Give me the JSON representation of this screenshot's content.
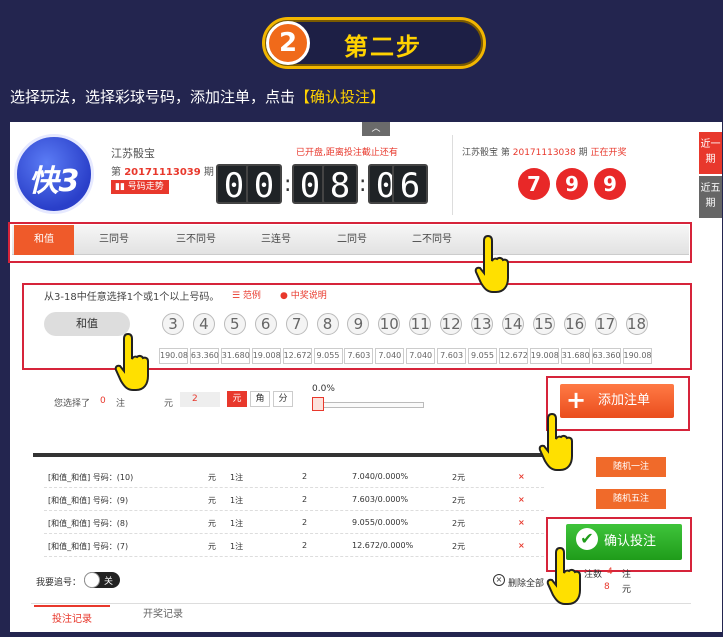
{
  "step": {
    "number": "2",
    "title": "第二步"
  },
  "intro": {
    "prefix": "选择玩法，选择彩球号码，添加注单，点击",
    "highlight": "【确认投注】"
  },
  "game": {
    "logo_text": "快3",
    "name": "江苏骰宝",
    "issue_prefix": "第",
    "issue": "20171113039",
    "issue_suffix": "期",
    "trend_label": "号码走势",
    "countdown_note": "已开盘,距离投注截止还有",
    "countdown": [
      "0",
      "0",
      "0",
      "8",
      "0",
      "6"
    ]
  },
  "result": {
    "name": "江苏骰宝 第",
    "issue": "20171113038",
    "suffix": "期",
    "status": "正在开奖",
    "balls": [
      "7",
      "9",
      "9"
    ]
  },
  "side_tabs": [
    "近一期",
    "近五期"
  ],
  "tabs": [
    "和值",
    "三同号",
    "三不同号",
    "三连号",
    "二同号",
    "二不同号"
  ],
  "hint": "从3-18中任意选择1个或1个以上号码。",
  "hint_links": [
    "☰ 范例",
    "● 中奖说明"
  ],
  "sum_label": "和值",
  "numbers": [
    "3",
    "4",
    "5",
    "6",
    "7",
    "8",
    "9",
    "10",
    "11",
    "12",
    "13",
    "14",
    "15",
    "16",
    "17",
    "18"
  ],
  "odds": [
    "190.08",
    "63.360",
    "31.680",
    "19.008",
    "12.672",
    "9.055",
    "7.603",
    "7.040",
    "7.040",
    "7.603",
    "9.055",
    "12.672",
    "19.008",
    "31.680",
    "63.360",
    "190.08"
  ],
  "selection": {
    "label": "您选择了",
    "count": "0",
    "zhu": "注",
    "yuan": "元",
    "amount": "2",
    "units": [
      "元",
      "角",
      "分"
    ],
    "rebate": "0.0%"
  },
  "add_label": "添加注单",
  "orders": [
    {
      "desc": "[和值_和值] 号码：(10)",
      "unit": "元",
      "bets": "1注",
      "mult": "2",
      "odds": "7.040/0.000%",
      "amount": "2元",
      "del": "×"
    },
    {
      "desc": "[和值_和值] 号码：(9)",
      "unit": "元",
      "bets": "1注",
      "mult": "2",
      "odds": "7.603/0.000%",
      "amount": "2元",
      "del": "×"
    },
    {
      "desc": "[和值_和值] 号码：(8)",
      "unit": "元",
      "bets": "1注",
      "mult": "2",
      "odds": "9.055/0.000%",
      "amount": "2元",
      "del": "×"
    },
    {
      "desc": "[和值_和值] 号码：(7)",
      "unit": "元",
      "bets": "1注",
      "mult": "2",
      "odds": "12.672/0.000%",
      "amount": "2元",
      "del": "×"
    }
  ],
  "random_buttons": [
    "随机一注",
    "随机五注"
  ],
  "confirm_label": "确认投注",
  "chase": {
    "label": "我要追号：",
    "toggle": "关"
  },
  "clear_label": "删除全部",
  "totals": {
    "bets_label": "注数",
    "bets": "4",
    "bets_unit": "注",
    "amount": "8",
    "amount_unit": "元"
  },
  "bottom_tabs": [
    "投注记录",
    "开奖记录"
  ]
}
